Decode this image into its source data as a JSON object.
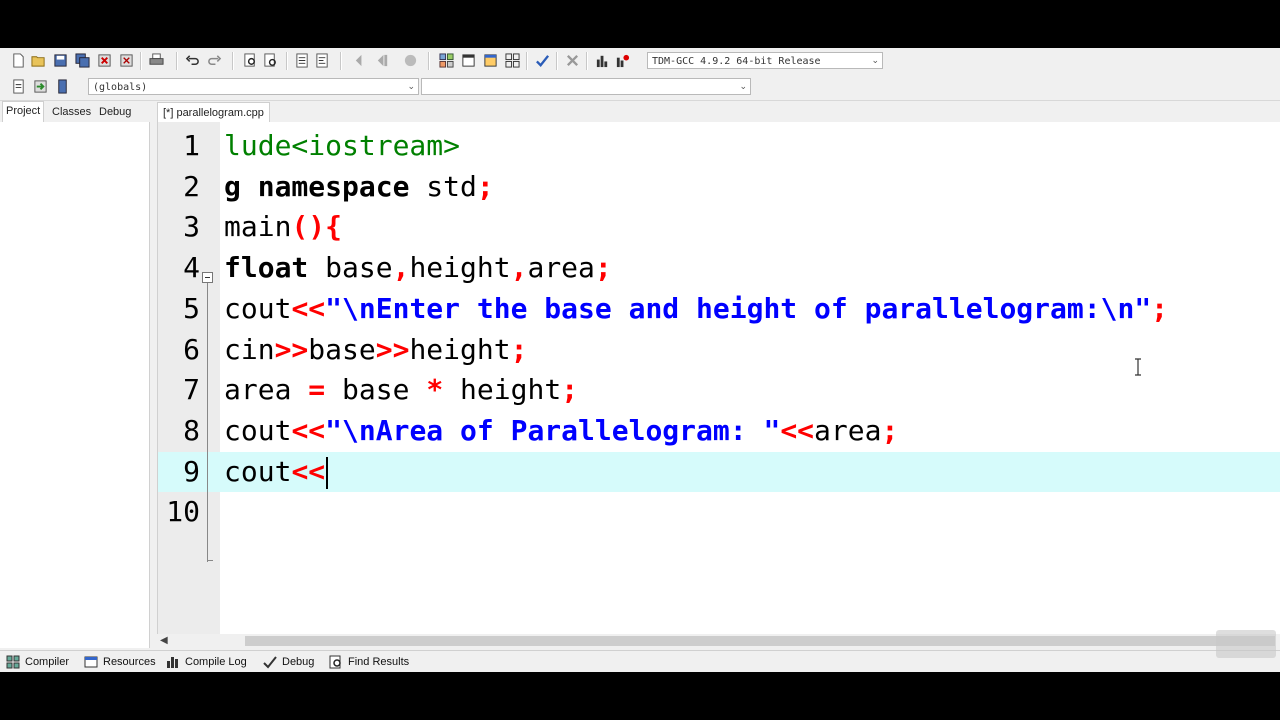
{
  "toolbar": {
    "compiler_select": "TDM-GCC 4.9.2 64-bit Release",
    "icons": [
      "new-file-icon",
      "open-icon",
      "save-icon",
      "save-all-icon",
      "close-icon",
      "close-all-icon",
      "print-icon",
      "undo-icon",
      "redo-icon",
      "find-icon",
      "replace-icon",
      "indent-icon",
      "unindent-icon",
      "bookmark-prev-icon",
      "bookmark-next-icon",
      "goto-icon",
      "new-project-icon",
      "project-options-icon",
      "class-browser-icon",
      "grid-icon",
      "check-icon",
      "delete-icon",
      "chart-icon",
      "profile-icon"
    ]
  },
  "toolbar2": {
    "scope_select": "(globals)",
    "function_select": ""
  },
  "left_tabs": [
    "Project",
    "Classes",
    "Debug"
  ],
  "file_tab": "[*] parallelogram.cpp",
  "editor": {
    "line_numbers": [
      "1",
      "2",
      "3",
      "4",
      "5",
      "6",
      "7",
      "8",
      "9",
      "10"
    ],
    "lines": [
      [
        {
          "t": "lude<iostream>",
          "c": "pp"
        }
      ],
      [
        {
          "t": "g namespace",
          "c": "kw"
        },
        {
          "t": " std",
          "c": ""
        },
        {
          "t": ";",
          "c": "op"
        }
      ],
      [
        {
          "t": "main",
          "c": ""
        },
        {
          "t": "(){",
          "c": "op"
        }
      ],
      [
        {
          "t": "float",
          "c": "kw"
        },
        {
          "t": " base",
          "c": ""
        },
        {
          "t": ",",
          "c": "op"
        },
        {
          "t": "height",
          "c": ""
        },
        {
          "t": ",",
          "c": "op"
        },
        {
          "t": "area",
          "c": ""
        },
        {
          "t": ";",
          "c": "op"
        }
      ],
      [
        {
          "t": "cout",
          "c": ""
        },
        {
          "t": "<<",
          "c": "op"
        },
        {
          "t": "\"\\nEnter the base and height of parallelogram:\\n\"",
          "c": "str"
        },
        {
          "t": ";",
          "c": "op"
        }
      ],
      [
        {
          "t": "cin",
          "c": ""
        },
        {
          "t": ">>",
          "c": "op"
        },
        {
          "t": "base",
          "c": ""
        },
        {
          "t": ">>",
          "c": "op"
        },
        {
          "t": "height",
          "c": ""
        },
        {
          "t": ";",
          "c": "op"
        }
      ],
      [
        {
          "t": "area ",
          "c": ""
        },
        {
          "t": "=",
          "c": "op"
        },
        {
          "t": " base ",
          "c": ""
        },
        {
          "t": "*",
          "c": "op"
        },
        {
          "t": " height",
          "c": ""
        },
        {
          "t": ";",
          "c": "op"
        }
      ],
      [
        {
          "t": "cout",
          "c": ""
        },
        {
          "t": "<<",
          "c": "op"
        },
        {
          "t": "\"\\nArea of Parallelogram: \"",
          "c": "str"
        },
        {
          "t": "<<",
          "c": "op"
        },
        {
          "t": "area",
          "c": ""
        },
        {
          "t": ";",
          "c": "op"
        }
      ],
      [
        {
          "t": "cout",
          "c": ""
        },
        {
          "t": "<<",
          "c": "op"
        }
      ],
      []
    ],
    "current_line": 9
  },
  "bottom_tabs": [
    "Compiler",
    "Resources",
    "Compile Log",
    "Debug",
    "Find Results"
  ]
}
